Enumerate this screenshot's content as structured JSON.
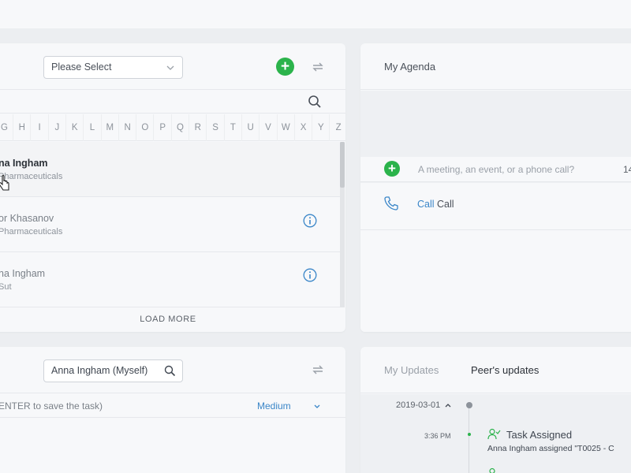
{
  "contacts": {
    "filter_select": "Please Select",
    "letters": [
      "G",
      "H",
      "I",
      "J",
      "K",
      "L",
      "M",
      "N",
      "O",
      "P",
      "Q",
      "R",
      "S",
      "T",
      "U",
      "V",
      "W",
      "X",
      "Y",
      "Z"
    ],
    "rows": [
      {
        "name": "na Ingham",
        "company": "Pharmaceuticals"
      },
      {
        "name": "or Khasanov",
        "company": "Pharmaceuticals"
      },
      {
        "name": "na Ingham",
        "company": "Sut"
      }
    ],
    "load_more": "LOAD MORE"
  },
  "agenda": {
    "title": "My Agenda",
    "input_placeholder": "A meeting, an event, or a phone call?",
    "input_time": "14",
    "call_type": "Call",
    "call_label": "Call"
  },
  "tasks": {
    "assignee": "Anna Ingham (Myself)",
    "hint": "ENTER to save the task)",
    "priority": "Medium"
  },
  "updates": {
    "tabs": [
      "My Updates",
      "Peer's updates"
    ],
    "date": "2019-03-01",
    "time": "3:36 PM",
    "event_title": "Task Assigned",
    "event_detail": "Anna Ingham assigned \"T0025 - C"
  },
  "colors": {
    "accent_green": "#2bb34b",
    "link_blue": "#3a86c8"
  }
}
